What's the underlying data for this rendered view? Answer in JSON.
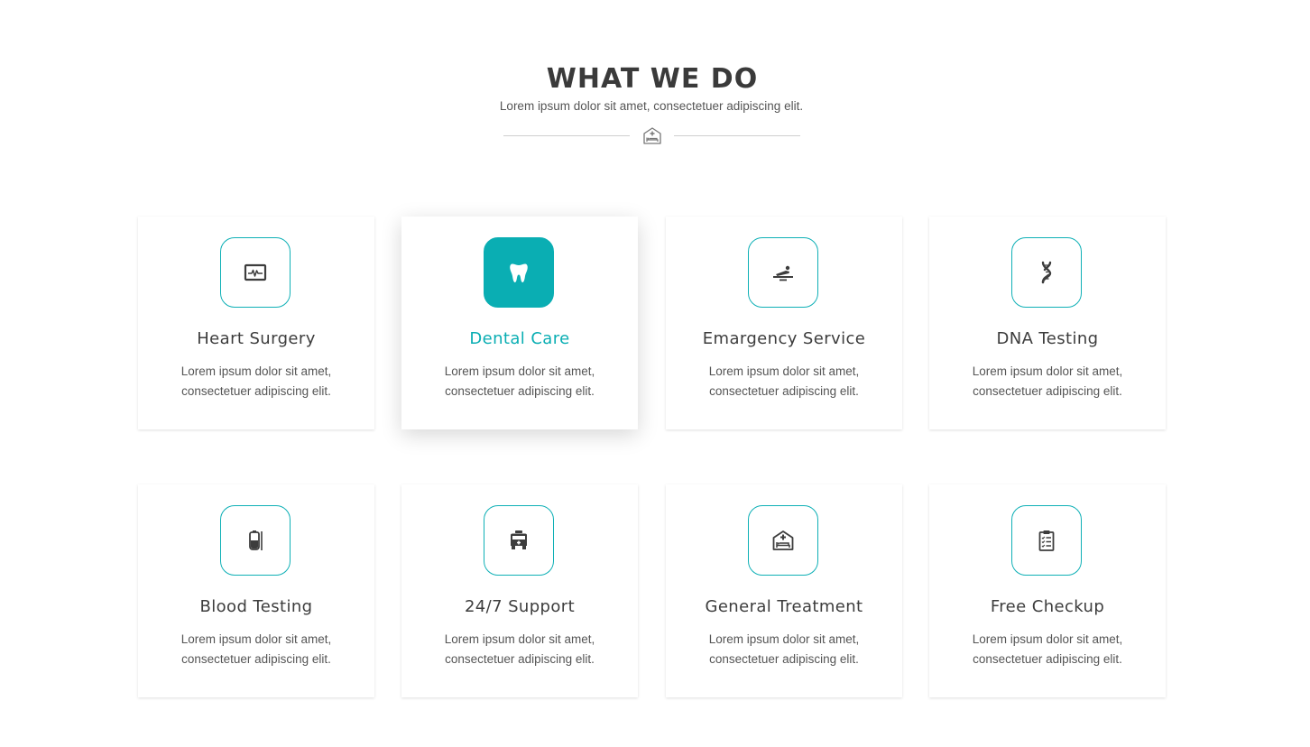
{
  "header": {
    "title": "WHAT WE DO",
    "subtitle": "Lorem ipsum dolor sit amet, consectetuer adipiscing elit.",
    "divider_icon": "hospital-bed-icon"
  },
  "colors": {
    "accent": "#0aaeb3",
    "title": "#3a3a3a",
    "text": "#555555"
  },
  "services": [
    {
      "title": "Heart Surgery",
      "text": "Lorem ipsum dolor sit amet, consectetuer adipiscing elit.",
      "icon": "heart-monitor-icon",
      "active": false
    },
    {
      "title": "Dental Care",
      "text": "Lorem ipsum dolor sit amet, consectetuer adipiscing elit.",
      "icon": "tooth-icon",
      "active": true
    },
    {
      "title": "Emargency Service",
      "text": "Lorem ipsum dolor sit amet, consectetuer adipiscing elit.",
      "icon": "patient-bed-icon",
      "active": false
    },
    {
      "title": "DNA Testing",
      "text": "Lorem ipsum dolor sit amet, consectetuer adipiscing elit.",
      "icon": "dna-icon",
      "active": false
    },
    {
      "title": "Blood Testing",
      "text": "Lorem ipsum dolor sit amet, consectetuer adipiscing elit.",
      "icon": "blood-bag-icon",
      "active": false
    },
    {
      "title": "24/7 Support",
      "text": "Lorem ipsum dolor sit amet, consectetuer adipiscing elit.",
      "icon": "ambulance-icon",
      "active": false
    },
    {
      "title": "General Treatment",
      "text": "Lorem ipsum dolor sit amet, consectetuer adipiscing elit.",
      "icon": "hospital-icon",
      "active": false
    },
    {
      "title": "Free Checkup",
      "text": "Lorem ipsum dolor sit amet, consectetuer adipiscing elit.",
      "icon": "clipboard-checklist-icon",
      "active": false
    }
  ]
}
